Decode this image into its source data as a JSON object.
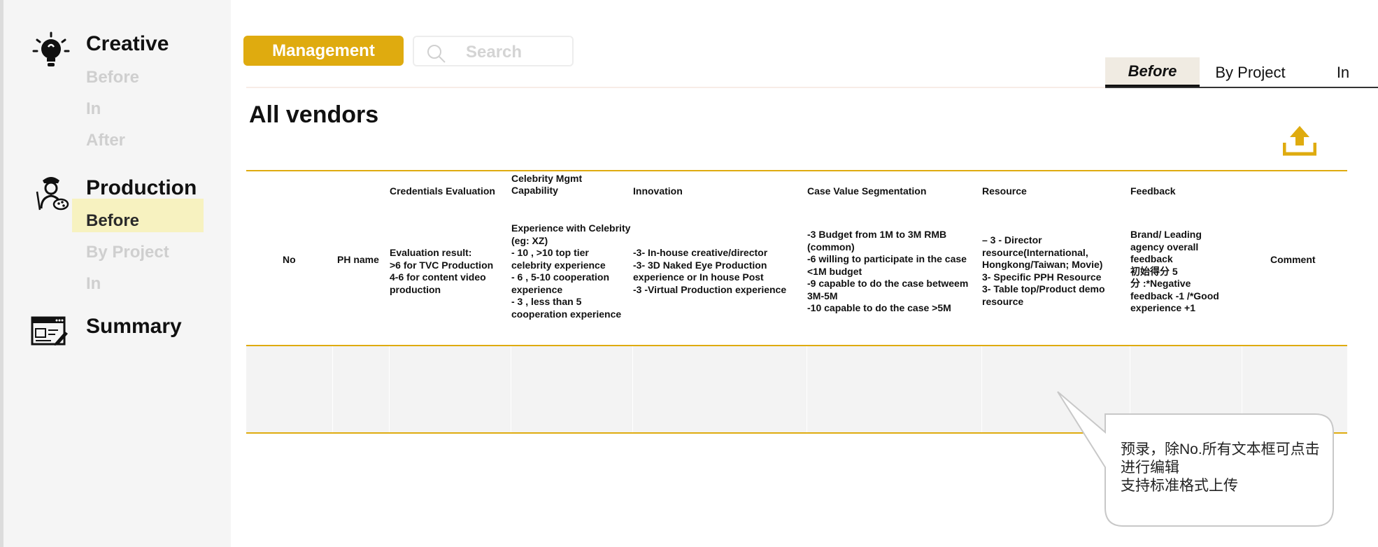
{
  "sidebar": {
    "creative": {
      "title": "Creative",
      "items": [
        "Before",
        "In",
        "After"
      ]
    },
    "production": {
      "title": "Production",
      "items": [
        "Before",
        "By Project",
        "In"
      ],
      "active_index": 0
    },
    "summary": {
      "title": "Summary"
    }
  },
  "toolbar": {
    "management_label": "Management",
    "search_placeholder": "Search"
  },
  "tabs": [
    {
      "label": "Before",
      "active": true
    },
    {
      "label": "By Project",
      "active": false
    },
    {
      "label": "In",
      "active": false
    }
  ],
  "page_title": "All vendors",
  "table": {
    "columns": [
      {
        "title": "",
        "desc": "No"
      },
      {
        "title": "",
        "desc": "PH  name"
      },
      {
        "title": "Credentials Evaluation",
        "desc": "Evaluation result:\n>6  for TVC Production\n4-6 for content video production"
      },
      {
        "title": "Celebrity Mgmt Capability",
        "desc": "Experience with Celebrity (eg: XZ)\n  - 10 , >10 top tier celebrity  experience\n  - 6   , 5-10 cooperation experience\n  - 3  , less than 5 cooperation experience"
      },
      {
        "title": "Innovation",
        "desc": "-3- In-house creative/director\n-3- 3D Naked Eye Production experience or In house Post\n-3 -Virtual Production experience"
      },
      {
        "title": "Case Value Segmentation",
        "desc": "-3 Budget from 1M to 3M RMB (common)\n-6 willing to participate in the case <1M budget\n-9 capable to do the case betweem 3M-5M\n-10 capable to do the case >5M"
      },
      {
        "title": "Resource",
        "desc": "– 3 - Director resource(International, Hongkong/Taiwan; Movie)\n 3- Specific PPH Resource\n3- Table top/Product demo resource"
      },
      {
        "title": "Feedback",
        "desc": "Brand/ Leading agency overall feedback\n初始得分 5\n分 :*Negative feedback -1 /*Good experience +1"
      },
      {
        "title": "",
        "desc": "Comment"
      }
    ]
  },
  "callout": {
    "text": "预录，除No.所有文本框可点击进行编辑\n支持标准格式上传"
  },
  "colors": {
    "accent": "#dfab0f",
    "highlight": "#f7f2c0",
    "sidebar_bg": "#f5f5f5"
  },
  "icons": [
    "lightbulb-icon",
    "artist-icon",
    "summary-icon",
    "search-icon",
    "upload-icon"
  ]
}
